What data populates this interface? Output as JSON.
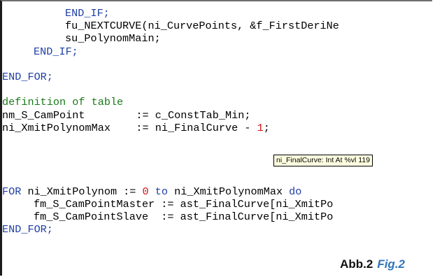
{
  "code_lines": [
    {
      "indent": 2,
      "segments": [
        {
          "text": "END_IF;",
          "type": "keyword"
        }
      ]
    },
    {
      "indent": 2,
      "segments": [
        {
          "text": "fu_NEXTCURVE(ni_CurvePoints, &f_FirstDeriNe",
          "type": "plain"
        }
      ]
    },
    {
      "indent": 2,
      "segments": [
        {
          "text": "su_PolynomMain;",
          "type": "plain"
        }
      ]
    },
    {
      "indent": 1,
      "segments": [
        {
          "text": "END_IF;",
          "type": "keyword"
        }
      ]
    },
    {
      "indent": 0,
      "segments": []
    },
    {
      "indent": 0,
      "segments": [
        {
          "text": "END_FOR;",
          "type": "keyword"
        }
      ]
    },
    {
      "indent": 0,
      "segments": []
    },
    {
      "indent": 0,
      "segments": [
        {
          "text": "definition of table",
          "type": "comment"
        }
      ]
    },
    {
      "indent": 0,
      "segments": [
        {
          "text": "nm_S_CamPoint        := c_ConstTab_Min;",
          "type": "plain"
        }
      ]
    },
    {
      "indent": 0,
      "segments": [
        {
          "text": "ni_XmitPolynomMax    := ni_FinalCurve - ",
          "type": "plain"
        },
        {
          "text": "1",
          "type": "number"
        },
        {
          "text": ";",
          "type": "plain"
        }
      ]
    },
    {
      "indent": 0,
      "segments": []
    },
    {
      "indent": 0,
      "segments": []
    },
    {
      "indent": 0,
      "segments": []
    },
    {
      "indent": 0,
      "segments": []
    },
    {
      "indent": 0,
      "segments": [
        {
          "text": "FOR",
          "type": "keyword"
        },
        {
          "text": " ni_XmitPolynom := ",
          "type": "plain"
        },
        {
          "text": "0",
          "type": "number"
        },
        {
          "text": " ",
          "type": "plain"
        },
        {
          "text": "to",
          "type": "keyword"
        },
        {
          "text": " ni_XmitPolynomMax ",
          "type": "plain"
        },
        {
          "text": "do",
          "type": "keyword"
        }
      ]
    },
    {
      "indent": 1,
      "segments": [
        {
          "text": "fm_S_CamPointMaster := ast_FinalCurve[ni_XmitPo",
          "type": "plain"
        }
      ]
    },
    {
      "indent": 1,
      "segments": [
        {
          "text": "fm_S_CamPointSlave  := ast_FinalCurve[ni_XmitPo",
          "type": "plain"
        }
      ]
    },
    {
      "indent": 0,
      "segments": [
        {
          "text": "END_FOR;",
          "type": "keyword"
        }
      ]
    }
  ],
  "tooltip": {
    "text": "ni_FinalCurve: Int At %vl 119"
  },
  "caption": {
    "de": "Abb.2",
    "en": "Fig.2"
  },
  "colors": {
    "keyword": "#1f3ea3",
    "comment": "#197a19",
    "number": "#d01212",
    "text": "#000000",
    "tooltip_background": "#ffffe1",
    "caption_en": "#2f73b8"
  }
}
